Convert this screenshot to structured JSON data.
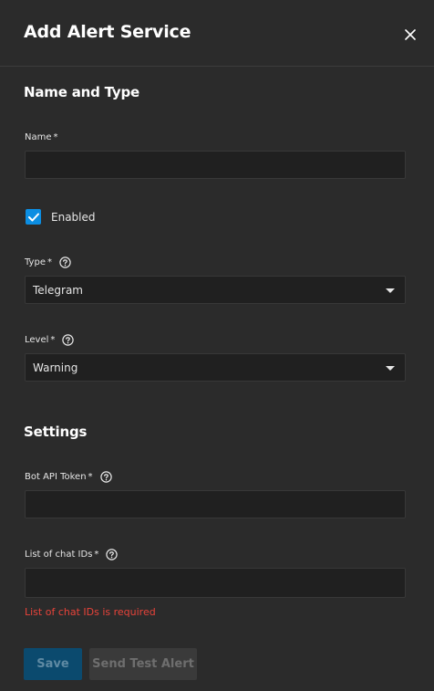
{
  "dialog": {
    "title": "Add Alert Service",
    "close_icon": "close-icon"
  },
  "name_and_type": {
    "heading": "Name and Type",
    "name": {
      "label": "Name",
      "required_mark": "*",
      "value": ""
    },
    "enabled": {
      "label": "Enabled",
      "checked": true
    },
    "type": {
      "label": "Type",
      "required_mark": "*",
      "value": "Telegram"
    },
    "level": {
      "label": "Level",
      "required_mark": "*",
      "value": "Warning"
    }
  },
  "settings": {
    "heading": "Settings",
    "bot_api_token": {
      "label": "Bot API Token",
      "required_mark": "*",
      "value": ""
    },
    "chat_ids": {
      "label": "List of chat IDs",
      "required_mark": "*",
      "value": "",
      "error": "List of chat IDs is required"
    }
  },
  "actions": {
    "save_label": "Save",
    "send_test_label": "Send Test Alert"
  },
  "colors": {
    "background": "#2b2b2b",
    "input_background": "#202020",
    "accent": "#0c8ee2",
    "error": "#e8433a"
  }
}
